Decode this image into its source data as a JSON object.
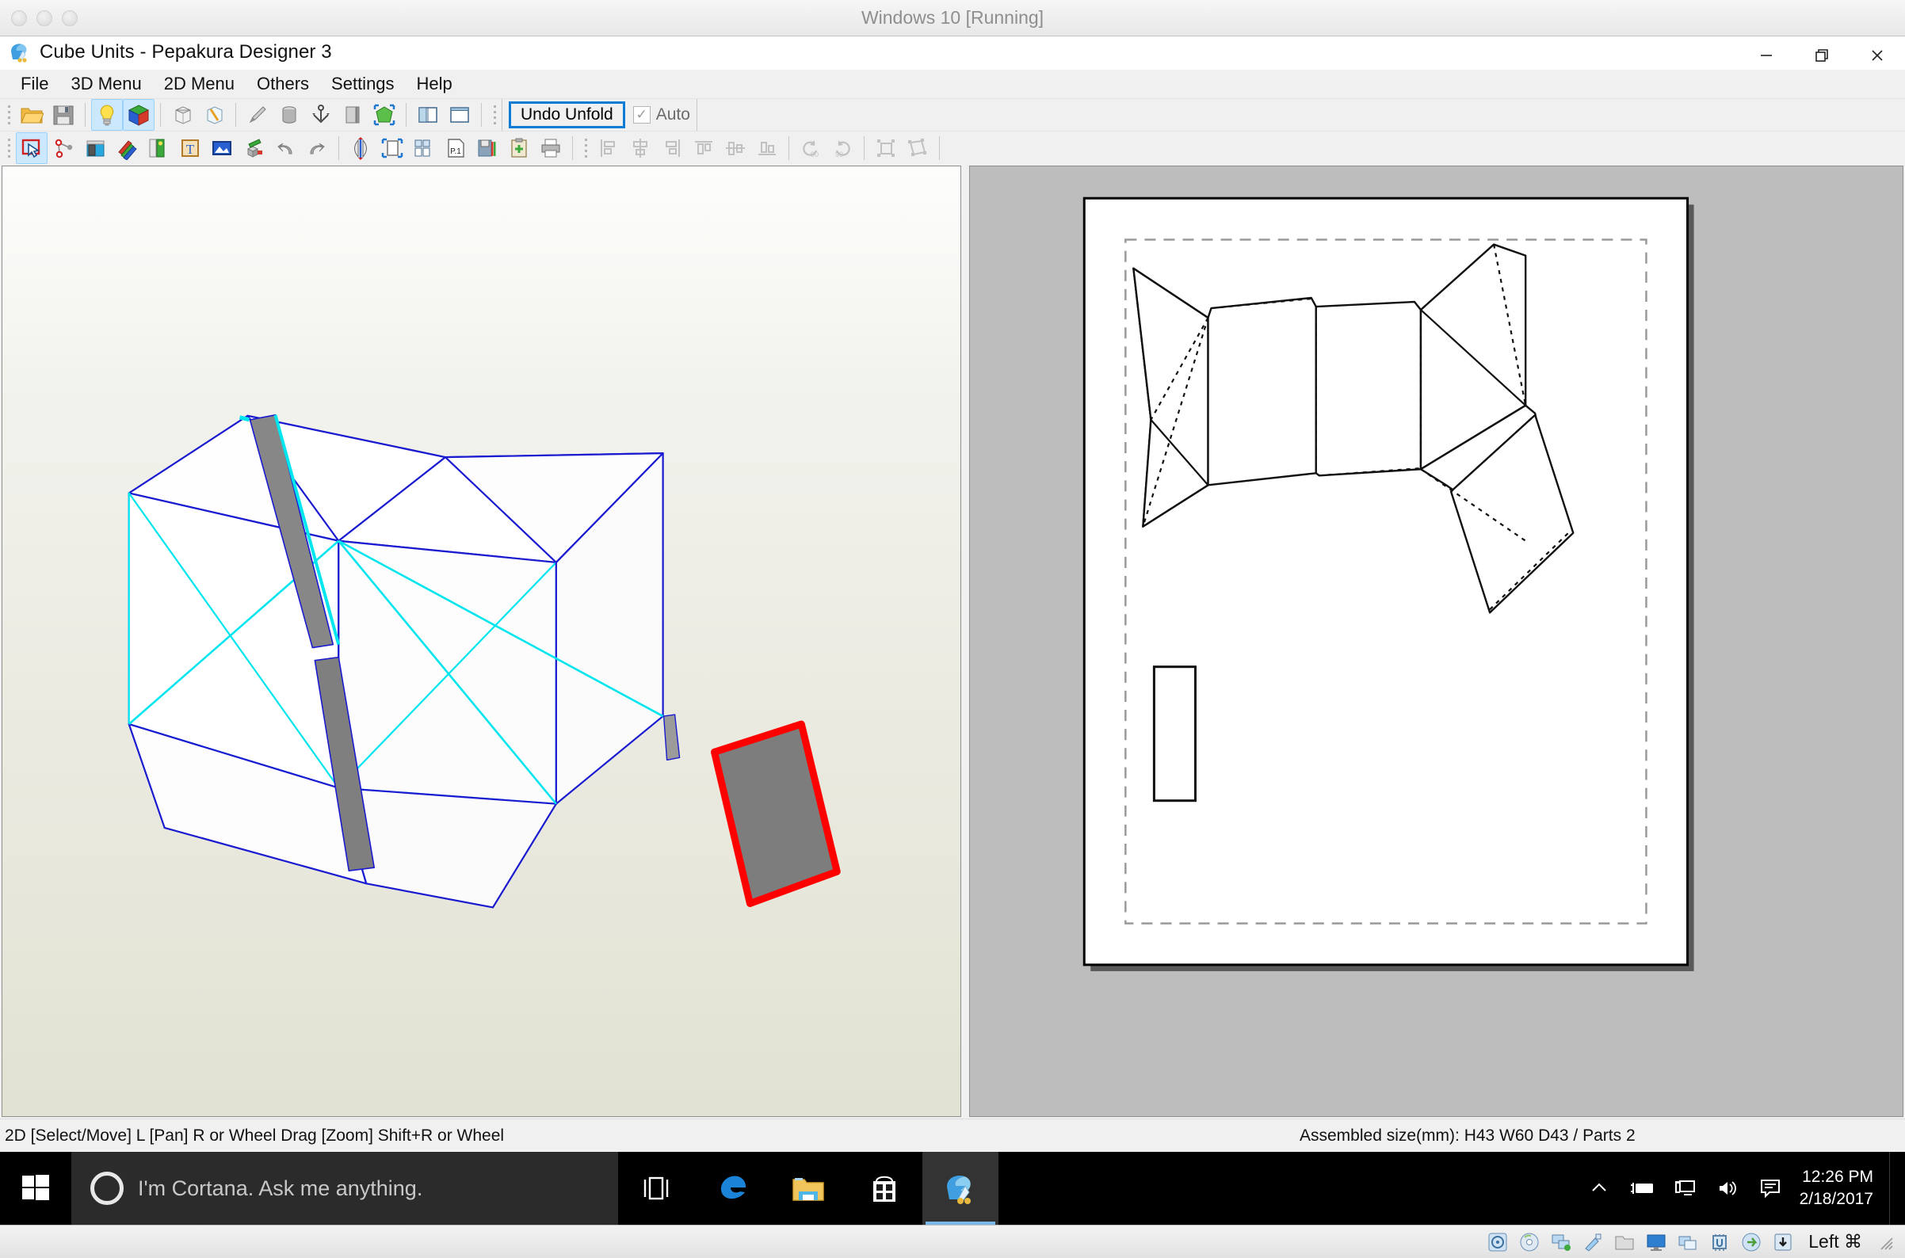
{
  "vbox": {
    "window_title": "Windows 10 [Running]",
    "host_key_label": "Left ⌘",
    "status_icons": [
      "hard-disk-icon",
      "optical-disk-icon",
      "network-icon",
      "usb-icon",
      "shared-folder-icon",
      "display-icon",
      "video-capture-icon",
      "virtualization-icon",
      "mouse-integration-icon",
      "keyboard-capture-icon"
    ]
  },
  "app": {
    "icon": "pepakura-app-icon",
    "title": "Cube Units  - Pepakura Designer 3",
    "window_buttons": {
      "minimize": "minimize-icon",
      "restore": "restore-icon",
      "close": "close-icon"
    },
    "menu": [
      {
        "label": "File"
      },
      {
        "label": "3D Menu"
      },
      {
        "label": "2D Menu"
      },
      {
        "label": "Others"
      },
      {
        "label": "Settings"
      },
      {
        "label": "Help"
      }
    ],
    "toolbar_row1": [
      {
        "name": "open-file-button",
        "icon": "folder-open-icon",
        "state": "normal"
      },
      {
        "name": "save-file-button",
        "icon": "floppy-disk-icon",
        "state": "normal"
      },
      {
        "name": "lighting-toggle-button",
        "icon": "lightbulb-icon",
        "state": "active"
      },
      {
        "name": "texture-toggle-button",
        "icon": "colored-cube-icon",
        "state": "active"
      },
      {
        "name": "show-flaps-button",
        "icon": "white-box-icon",
        "state": "normal"
      },
      {
        "name": "show-fold-lines-button",
        "icon": "box-stripe-icon",
        "state": "normal"
      },
      {
        "name": "unfold-tool-button",
        "icon": "pen-icon",
        "state": "normal"
      },
      {
        "name": "cylinder-tool-button",
        "icon": "cylinder-icon",
        "state": "normal"
      },
      {
        "name": "anchor-tool-button",
        "icon": "anchor-icon",
        "state": "normal"
      },
      {
        "name": "divide-face-button",
        "icon": "panel-icon",
        "state": "normal"
      },
      {
        "name": "select-shape-button",
        "icon": "green-shape-icon",
        "state": "normal"
      },
      {
        "name": "split-window-button",
        "icon": "split-view-icon",
        "state": "normal"
      },
      {
        "name": "single-window-button",
        "icon": "single-view-icon",
        "state": "normal"
      }
    ],
    "unfold_panel": {
      "undo_label": "Undo Unfold",
      "auto_label": "Auto",
      "auto_checked": true
    },
    "toolbar_row2": [
      {
        "name": "select-move-tool",
        "icon": "select-arrow-icon",
        "state": "active"
      },
      {
        "name": "edit-vertex-tool",
        "icon": "vertex-edit-icon",
        "state": "normal"
      },
      {
        "name": "notepad-tool",
        "icon": "notepad-icon",
        "state": "normal"
      },
      {
        "name": "marker-tool",
        "icon": "markers-icon",
        "state": "normal"
      },
      {
        "name": "measure-tool",
        "icon": "ruler-icon",
        "state": "normal"
      },
      {
        "name": "text-tool",
        "icon": "text-t-icon",
        "state": "normal"
      },
      {
        "name": "image-tool",
        "icon": "picture-icon",
        "state": "normal"
      },
      {
        "name": "glue-tool",
        "icon": "glue-box-icon",
        "state": "normal"
      },
      {
        "name": "undo-button",
        "icon": "undo-arrow-icon",
        "state": "normal"
      },
      {
        "name": "redo-button",
        "icon": "redo-arrow-icon",
        "state": "normal"
      },
      {
        "name": "flip-part-button",
        "icon": "flip-icon",
        "state": "normal"
      },
      {
        "name": "page-layout-button",
        "icon": "page-frame-icon",
        "state": "normal"
      },
      {
        "name": "arrange-parts-button",
        "icon": "arrange-icon",
        "state": "normal"
      },
      {
        "name": "page-number-button",
        "icon": "page-1-icon",
        "state": "normal"
      },
      {
        "name": "export-button",
        "icon": "export-icon",
        "state": "normal"
      },
      {
        "name": "clipboard-button",
        "icon": "clipboard-icon",
        "state": "normal"
      },
      {
        "name": "print-button",
        "icon": "printer-icon",
        "state": "normal"
      }
    ],
    "toolbar_row2b": [
      {
        "name": "align-left-button",
        "icon": "align-left-icon",
        "state": "disabled"
      },
      {
        "name": "align-center-horizontal-button",
        "icon": "align-center-h-icon",
        "state": "disabled"
      },
      {
        "name": "align-right-button",
        "icon": "align-right-icon",
        "state": "disabled"
      },
      {
        "name": "align-top-button",
        "icon": "align-top-icon",
        "state": "disabled"
      },
      {
        "name": "align-middle-vertical-button",
        "icon": "align-middle-v-icon",
        "state": "disabled"
      },
      {
        "name": "align-bottom-button",
        "icon": "align-bottom-icon",
        "state": "disabled"
      },
      {
        "name": "rotate-left-90-button",
        "icon": "rotate-left-90-icon",
        "label": "90",
        "state": "disabled"
      },
      {
        "name": "rotate-right-90-button",
        "icon": "rotate-right-90-icon",
        "label": "90",
        "state": "disabled"
      },
      {
        "name": "group-parts-button",
        "icon": "group-icon",
        "state": "disabled"
      },
      {
        "name": "ungroup-parts-button",
        "icon": "ungroup-icon",
        "state": "disabled"
      }
    ],
    "status": {
      "left": "2D [Select/Move] L [Pan] R or Wheel Drag [Zoom] Shift+R or Wheel",
      "right": "Assembled size(mm): H43 W60 D43 / Parts 2"
    },
    "view3d": {
      "name": "3d-model-viewport",
      "model_name": "Cube Units",
      "edge_color": "#1a1ad0",
      "highlight_edge_color": "#00e5ee",
      "selected_outline_color": "#ff0000",
      "face_color": "#ffffff",
      "shadow_face_color": "#808080"
    },
    "view2d": {
      "name": "2d-unfold-viewport",
      "background": "#bdbdbd",
      "page_color": "#ffffff",
      "margin_guide_color": "#9a9a9a",
      "cut_line_color": "#000000",
      "fold_line_style": "dotted",
      "parts_count": 2
    }
  },
  "taskbar": {
    "start_icon": "windows-start-icon",
    "cortana_placeholder": "I'm Cortana. Ask me anything.",
    "cortana_icon": "cortana-ring-icon",
    "apps": [
      {
        "name": "task-view-button",
        "icon": "task-view-icon",
        "running": false
      },
      {
        "name": "edge-browser-button",
        "icon": "edge-icon",
        "running": false
      },
      {
        "name": "file-explorer-button",
        "icon": "file-explorer-icon",
        "running": false
      },
      {
        "name": "microsoft-store-button",
        "icon": "store-bag-icon",
        "running": false
      },
      {
        "name": "pepakura-taskbar-button",
        "icon": "pepakura-app-icon",
        "running": true
      }
    ],
    "tray": [
      {
        "name": "show-hidden-icons-button",
        "icon": "chevron-up-icon"
      },
      {
        "name": "battery-button",
        "icon": "battery-charging-icon"
      },
      {
        "name": "network-button",
        "icon": "network-monitor-icon"
      },
      {
        "name": "volume-button",
        "icon": "speaker-icon"
      },
      {
        "name": "action-center-button",
        "icon": "notification-icon"
      }
    ],
    "clock": {
      "time": "12:26 PM",
      "date": "2/18/2017"
    }
  }
}
